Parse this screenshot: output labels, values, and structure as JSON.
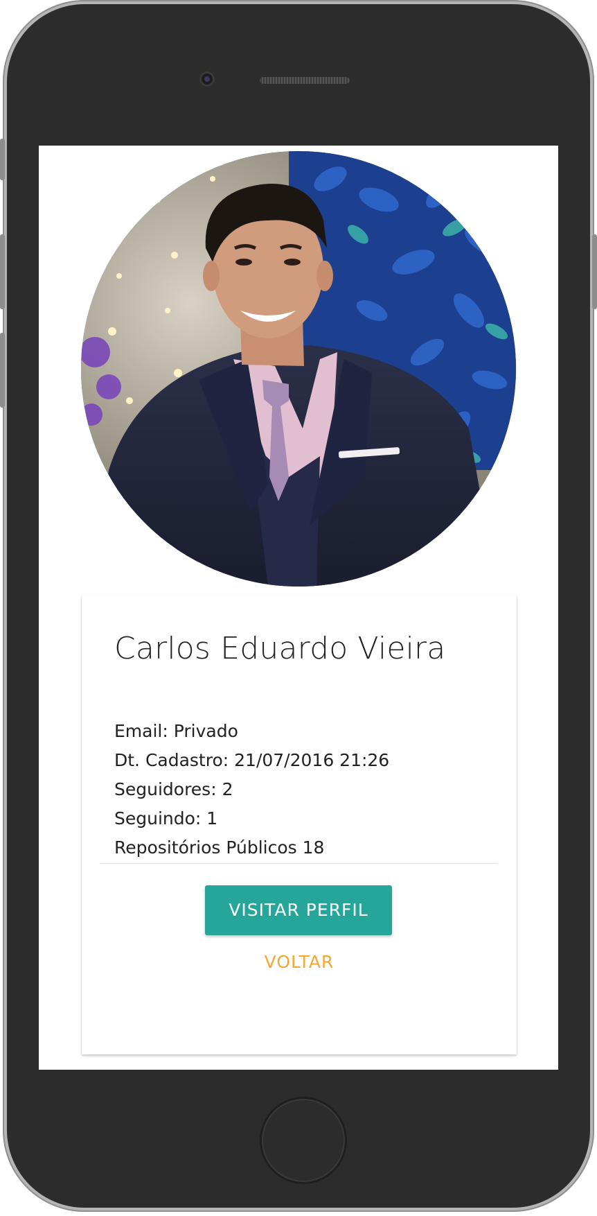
{
  "profile": {
    "name": "Carlos Eduardo Vieira",
    "email": "Email: Privado",
    "registered": "Dt. Cadastro: 21/07/2016 21:26",
    "followers": "Seguidores: 2",
    "following": "Seguindo: 1",
    "public_repos": "Repositórios Públicos 18"
  },
  "actions": {
    "visit_label": "VISITAR PERFIL",
    "back_label": "VOLTAR"
  },
  "colors": {
    "primary": "#26a69a",
    "secondary": "#f5a733",
    "device_body": "#2c2c2c"
  },
  "icons": {
    "avatar": "user-photo"
  }
}
